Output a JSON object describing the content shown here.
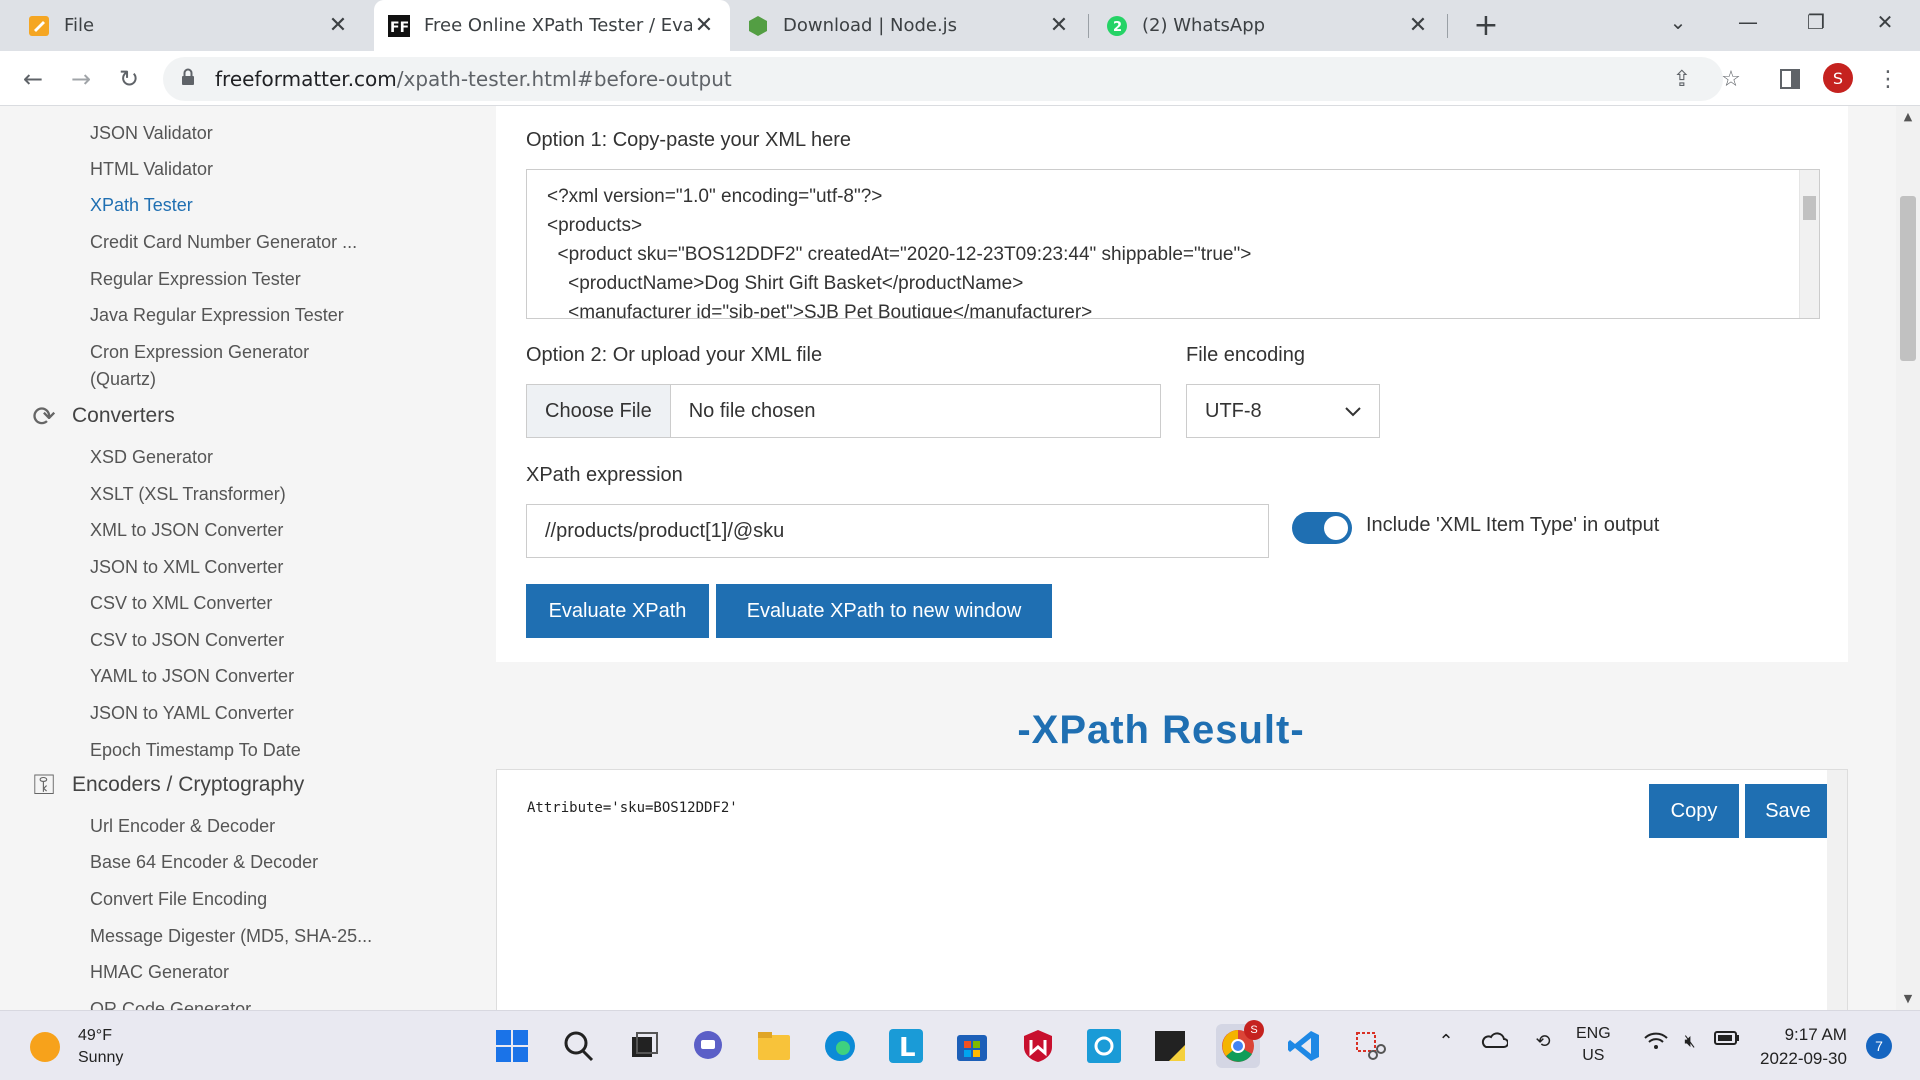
{
  "tabs": [
    {
      "title": "File",
      "icon": "file-icon"
    },
    {
      "title": "Free Online XPath Tester / Evalua",
      "icon": "freeformatter-icon",
      "active": true
    },
    {
      "title": "Download | Node.js",
      "icon": "nodejs-icon"
    },
    {
      "title": "(2) WhatsApp",
      "icon": "whatsapp-icon",
      "badge": "2"
    }
  ],
  "address": {
    "host": "freeformatter.com",
    "path": "/xpath-tester.html#before-output"
  },
  "profile_initial": "S",
  "sidebar": {
    "items_top": [
      "JSON Validator",
      "HTML Validator",
      "XPath Tester",
      "Credit Card Number Generator ...",
      "Regular Expression Tester",
      "Java Regular Expression Tester",
      "Cron Expression Generator",
      "(Quartz)"
    ],
    "converters_head": "Converters",
    "converters": [
      "XSD Generator",
      "XSLT (XSL Transformer)",
      "XML to JSON Converter",
      "JSON to XML Converter",
      "CSV to XML Converter",
      "CSV to JSON Converter",
      "YAML to JSON Converter",
      "JSON to YAML Converter",
      "Epoch Timestamp To Date"
    ],
    "encoders_head": "Encoders / Cryptography",
    "encoders": [
      "Url Encoder & Decoder",
      "Base 64 Encoder & Decoder",
      "Convert File Encoding",
      "Message Digester (MD5, SHA-25...",
      "HMAC Generator",
      "QR Code Generator"
    ]
  },
  "form": {
    "option1_label": "Option 1: Copy-paste your XML here",
    "xml_text": "<?xml version=\"1.0\" encoding=\"utf-8\"?>\n<products>\n  <product sku=\"BOS12DDF2\" createdAt=\"2020-12-23T09:23:44\" shippable=\"true\">\n    <productName>Dog Shirt Gift Basket</productName>\n    <manufacturer id=\"sjb-pet\">SJB Pet Boutique</manufacturer>",
    "option2_label": "Option 2: Or upload your XML file",
    "choose_file": "Choose File",
    "no_file": "No file chosen",
    "encoding_label": "File encoding",
    "encoding_value": "UTF-8",
    "xpath_label": "XPath expression",
    "xpath_value": "//products/product[1]/@sku",
    "toggle_label": "Include 'XML Item Type' in output",
    "toggle_on": true,
    "evaluate_btn": "Evaluate XPath",
    "evaluate_new_btn": "Evaluate XPath to new window"
  },
  "result": {
    "title": "-XPath Result-",
    "text": "Attribute='sku=BOS12DDF2'",
    "copy_btn": "Copy",
    "save_btn": "Save"
  },
  "taskbar": {
    "temp": "49°F",
    "condition": "Sunny",
    "lang1": "ENG",
    "lang2": "US",
    "time": "9:17 AM",
    "date": "2022-09-30",
    "notifications": "7",
    "chrome_badge": "S"
  }
}
